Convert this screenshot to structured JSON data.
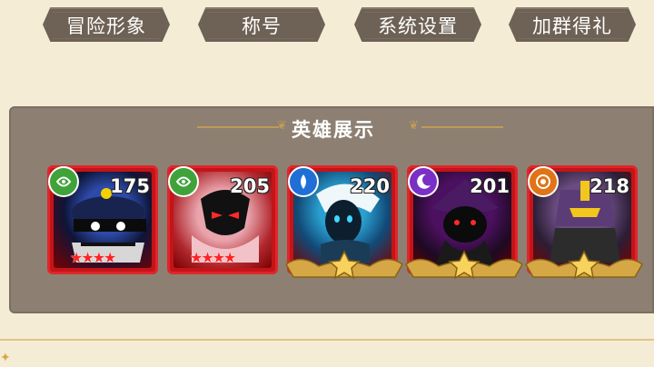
{
  "tabs": [
    {
      "label": "冒险形象"
    },
    {
      "label": "称号"
    },
    {
      "label": "系统设置"
    },
    {
      "label": "加群得礼"
    }
  ],
  "panel": {
    "title": "英雄展示"
  },
  "heroes": [
    {
      "level": "175",
      "element": "wind",
      "element_color": "#3fa33a",
      "stars": 4,
      "star_style": "red",
      "art_colors": [
        "#1a2a6b",
        "#0a0a0a"
      ]
    },
    {
      "level": "205",
      "element": "wind",
      "element_color": "#3fa33a",
      "stars": 4,
      "star_style": "red",
      "art_colors": [
        "#e8a0a8",
        "#111111"
      ]
    },
    {
      "level": "220",
      "element": "water",
      "element_color": "#1f6fd6",
      "stars": 1,
      "star_style": "gold",
      "art_colors": [
        "#1c7fae",
        "#e9f4f8"
      ]
    },
    {
      "level": "201",
      "element": "dark",
      "element_color": "#7a2fc6",
      "stars": 1,
      "star_style": "gold",
      "art_colors": [
        "#3a0a45",
        "#111111"
      ]
    },
    {
      "level": "218",
      "element": "fire",
      "element_color": "#e07417",
      "stars": 1,
      "star_style": "gold",
      "art_colors": [
        "#5a3a6a",
        "#f0c020"
      ]
    }
  ],
  "colors": {
    "background": "#f5ecd6",
    "panel": "#8d8072",
    "tab": "#6e6155",
    "card_border": "#e0262b",
    "gold": "#d6a845"
  }
}
